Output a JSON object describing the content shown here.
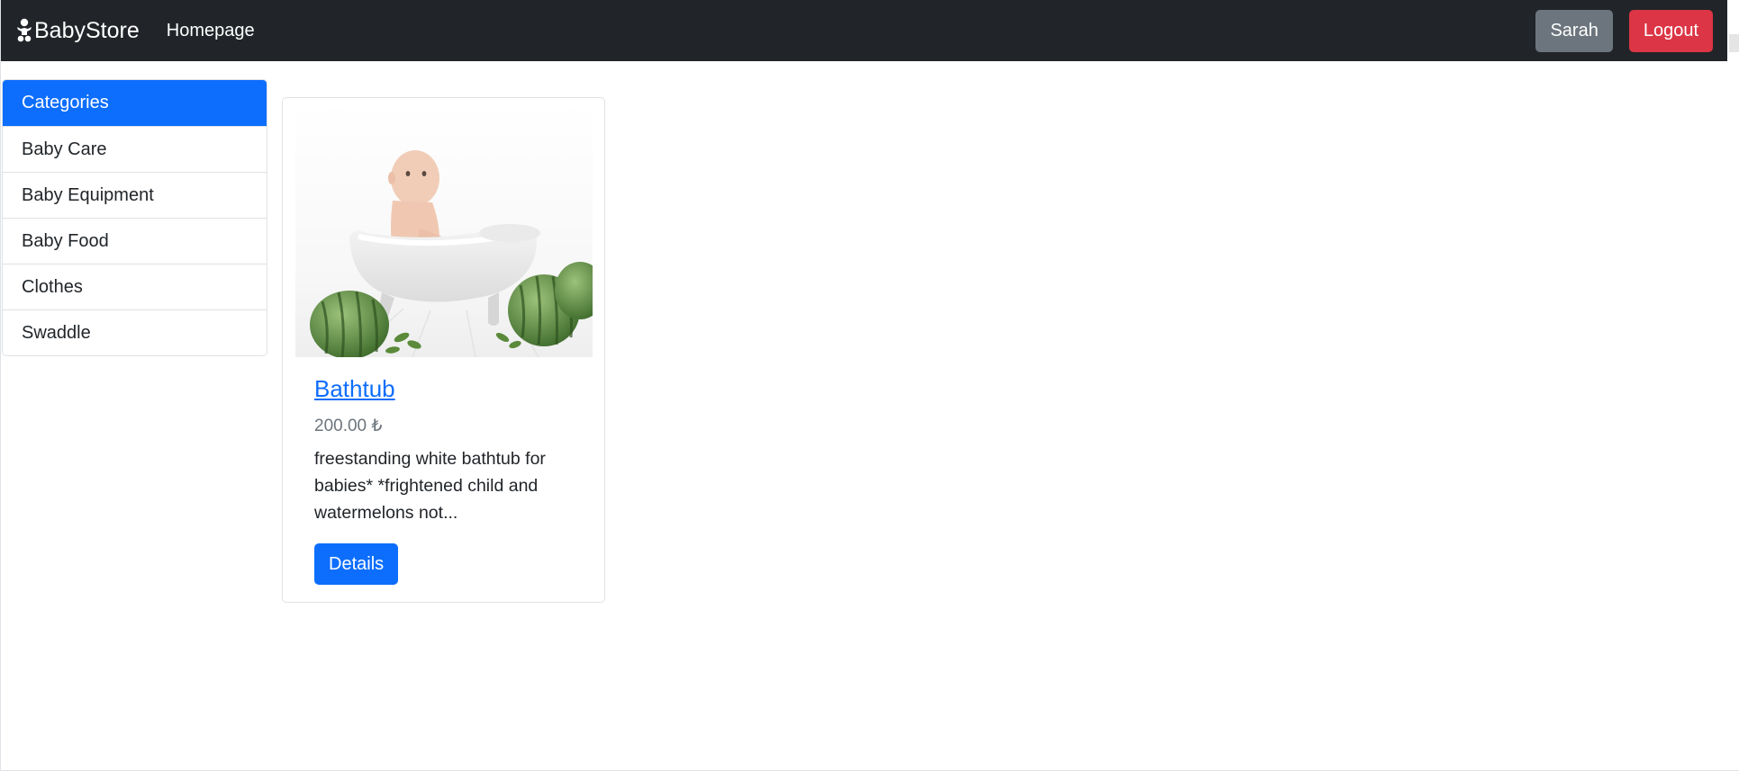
{
  "navbar": {
    "brand": "BabyStore",
    "brand_icon": "baby-icon",
    "home_link": "Homepage",
    "user_button": "Sarah",
    "logout_button": "Logout"
  },
  "sidebar": {
    "header": "Categories",
    "items": [
      {
        "label": "Baby Care"
      },
      {
        "label": "Baby Equipment"
      },
      {
        "label": "Baby Food"
      },
      {
        "label": "Clothes"
      },
      {
        "label": "Swaddle"
      }
    ]
  },
  "products": [
    {
      "title": "Bathtub",
      "price": "200.00 ₺",
      "description": "freestanding white bathtub for babies* *frightened child and watermelons not...",
      "details_button": "Details",
      "image": "baby-in-bathtub-with-watermelons"
    }
  ],
  "colors": {
    "navbar_bg": "#212529",
    "primary": "#0d6efd",
    "secondary": "#6c757d",
    "danger": "#dc3545"
  }
}
